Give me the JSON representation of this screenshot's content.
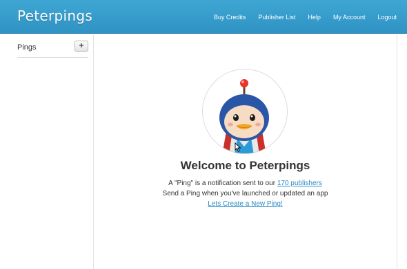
{
  "app": {
    "brand": "Peterpings"
  },
  "nav": {
    "items": [
      "Buy Credits",
      "Publisher List",
      "Help",
      "My Account",
      "Logout"
    ]
  },
  "sidebar": {
    "title": "Pings",
    "add_label": "+"
  },
  "main": {
    "welcome_title": "Welcome to Peterpings",
    "line1_prefix": "A \"Ping\" is a notification sent to our ",
    "line1_link": "170 publishers",
    "line2": "Send a Ping when you've launched or updated an app",
    "line3_link": "Lets Create a New Ping!"
  },
  "colors": {
    "header": "#3b9fd0",
    "link": "#2a8ac6",
    "text": "#333333"
  },
  "icons": {
    "mascot": "penguin-mascot-icon",
    "cursor": "mouse-pointer-icon"
  }
}
